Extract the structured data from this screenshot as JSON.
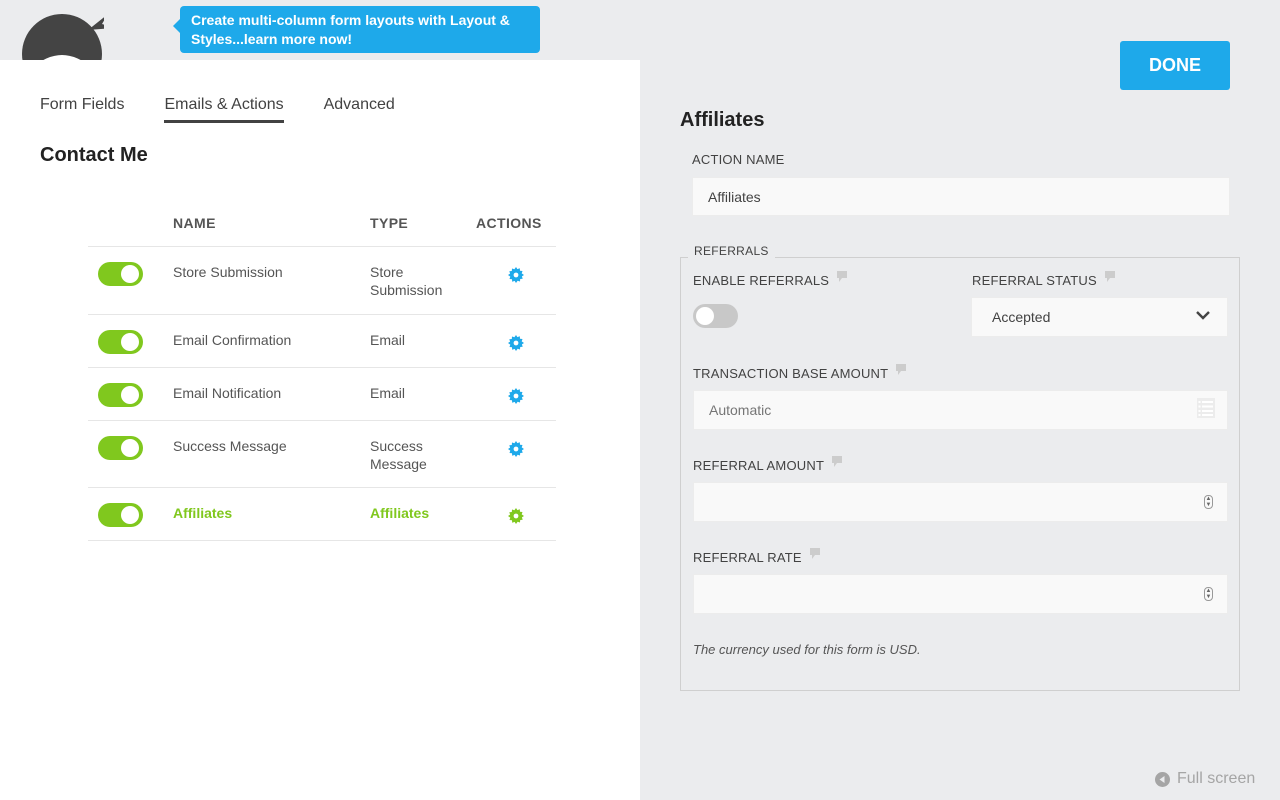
{
  "promo": {
    "text": "Create multi-column form layouts with Layout & Styles...learn more now!"
  },
  "tabs": [
    {
      "label": "Form Fields",
      "active": false
    },
    {
      "label": "Emails & Actions",
      "active": true
    },
    {
      "label": "Advanced",
      "active": false
    }
  ],
  "form_title": "Contact Me",
  "table": {
    "headers": {
      "name": "NAME",
      "type": "TYPE",
      "actions": "ACTIONS"
    },
    "rows": [
      {
        "enabled": true,
        "name": "Store Submission",
        "type_line1": "Store",
        "type_line2": "Submission",
        "active": false
      },
      {
        "enabled": true,
        "name": "Email Confirmation",
        "type_line1": "Email",
        "type_line2": "",
        "active": false
      },
      {
        "enabled": true,
        "name": "Email Notification",
        "type_line1": "Email",
        "type_line2": "",
        "active": false
      },
      {
        "enabled": true,
        "name": "Success Message",
        "type_line1": "Success",
        "type_line2": "Message",
        "active": false
      },
      {
        "enabled": true,
        "name": "Affiliates",
        "type_line1": "Affiliates",
        "type_line2": "",
        "active": true
      }
    ]
  },
  "drawer": {
    "done_label": "DONE",
    "title": "Affiliates",
    "action_name_label": "ACTION NAME",
    "action_name_value": "Affiliates",
    "referrals_legend": "REFERRALS",
    "enable_referrals_label": "ENABLE REFERRALS",
    "enable_referrals_on": false,
    "referral_status_label": "REFERRAL STATUS",
    "referral_status_value": "Accepted",
    "transaction_base_label": "TRANSACTION BASE AMOUNT",
    "transaction_base_placeholder": "Automatic",
    "referral_amount_label": "REFERRAL AMOUNT",
    "referral_amount_value": "",
    "referral_rate_label": "REFERRAL RATE",
    "referral_rate_value": "",
    "currency_note": "The currency used for this form is USD."
  },
  "fullscreen_label": "Full screen",
  "colors": {
    "accent_blue": "#1ea9ea",
    "active_green": "#80c81e",
    "text": "#424242"
  }
}
